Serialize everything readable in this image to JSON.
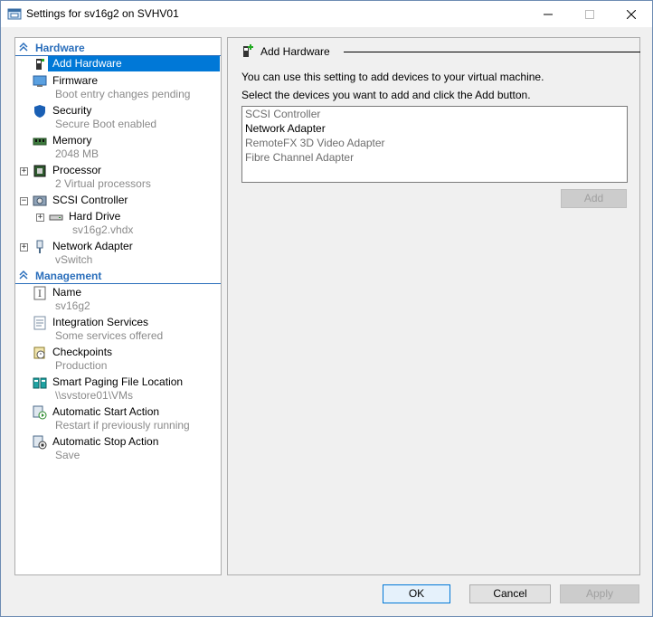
{
  "window": {
    "title": "Settings for sv16g2 on SVHV01",
    "min_icon": "minimize-icon",
    "max_icon": "maximize-icon",
    "close_icon": "close-icon"
  },
  "nav": {
    "hardware_header": "Hardware",
    "management_header": "Management",
    "items": [
      {
        "label": "Add Hardware",
        "sub": "",
        "icon": "add-hardware-icon"
      },
      {
        "label": "Firmware",
        "sub": "Boot entry changes pending",
        "icon": "firmware-icon"
      },
      {
        "label": "Security",
        "sub": "Secure Boot enabled",
        "icon": "shield-icon"
      },
      {
        "label": "Memory",
        "sub": "2048 MB",
        "icon": "memory-icon"
      },
      {
        "label": "Processor",
        "sub": "2 Virtual processors",
        "icon": "processor-icon"
      },
      {
        "label": "SCSI Controller",
        "sub": "",
        "icon": "scsi-controller-icon"
      },
      {
        "label": "Hard Drive",
        "sub": "sv16g2.vhdx",
        "icon": "hard-drive-icon"
      },
      {
        "label": "Network Adapter",
        "sub": "vSwitch",
        "icon": "network-adapter-icon"
      },
      {
        "label": "Name",
        "sub": "sv16g2",
        "icon": "name-icon"
      },
      {
        "label": "Integration Services",
        "sub": "Some services offered",
        "icon": "integration-services-icon"
      },
      {
        "label": "Checkpoints",
        "sub": "Production",
        "icon": "checkpoints-icon"
      },
      {
        "label": "Smart Paging File Location",
        "sub": "\\\\svstore01\\VMs",
        "icon": "smart-paging-icon"
      },
      {
        "label": "Automatic Start Action",
        "sub": "Restart if previously running",
        "icon": "auto-start-icon"
      },
      {
        "label": "Automatic Stop Action",
        "sub": "Save",
        "icon": "auto-stop-icon"
      }
    ]
  },
  "panel": {
    "title": "Add Hardware",
    "desc1": "You can use this setting to add devices to your virtual machine.",
    "desc2": "Select the devices you want to add and click the Add button.",
    "devices": [
      "SCSI Controller",
      "Network Adapter",
      "RemoteFX 3D Video Adapter",
      "Fibre Channel Adapter"
    ],
    "add_label": "Add"
  },
  "buttons": {
    "ok": "OK",
    "cancel": "Cancel",
    "apply": "Apply"
  },
  "colors": {
    "accent": "#2a6ebb",
    "selection": "#0078d7"
  }
}
